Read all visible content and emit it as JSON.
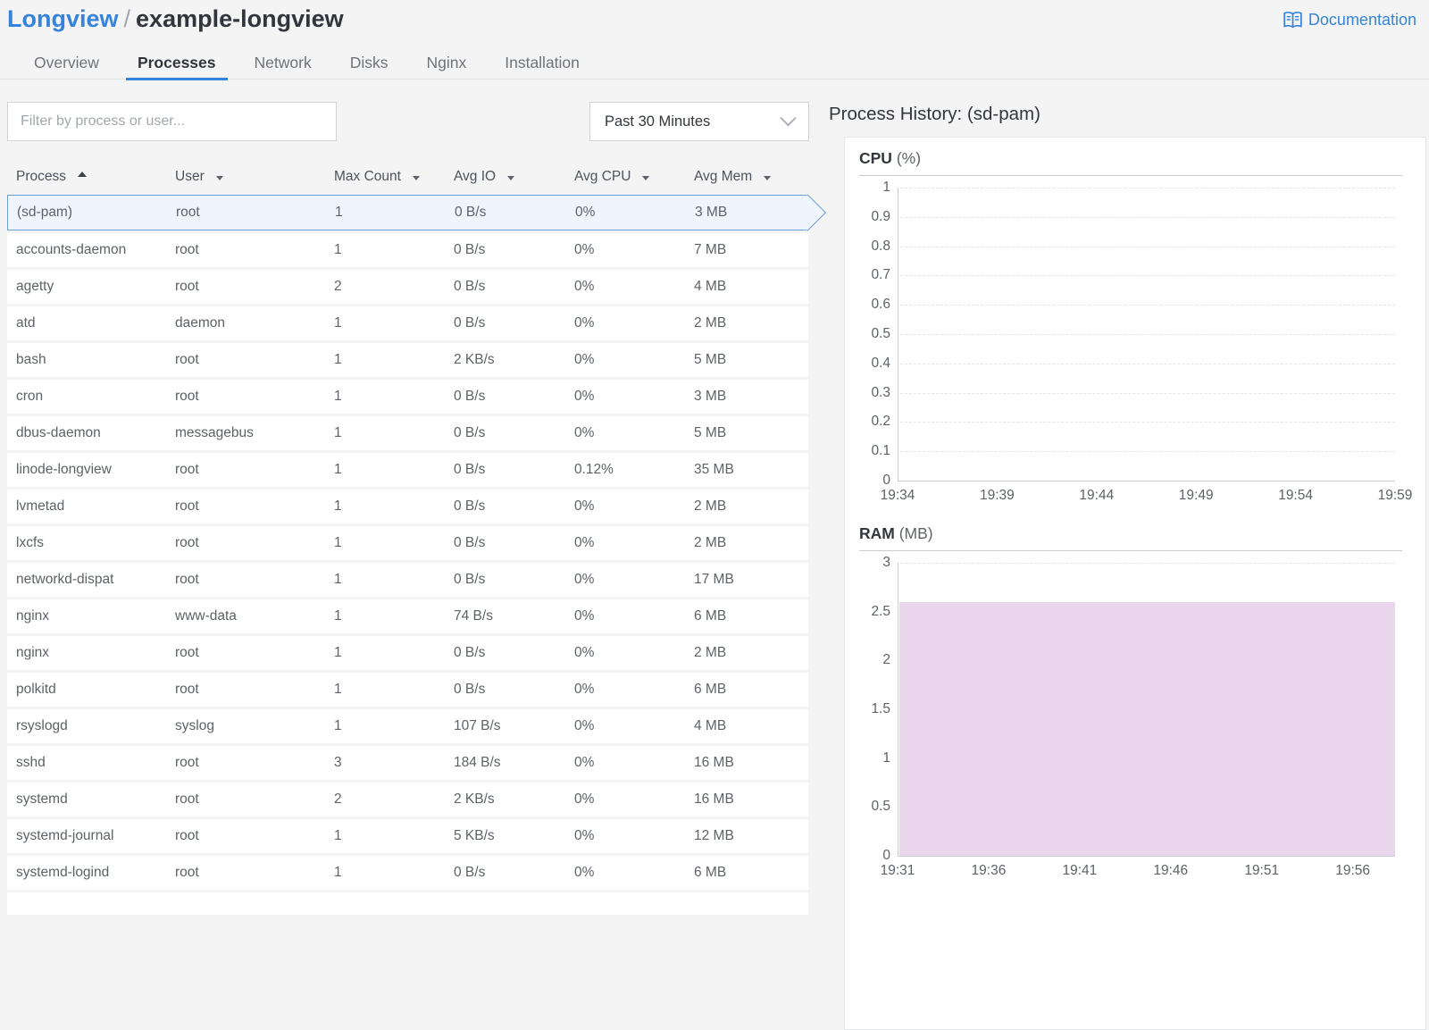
{
  "header": {
    "breadcrumb": {
      "section": "Longview",
      "separator": "/",
      "current": "example-longview"
    },
    "documentation_label": "Documentation"
  },
  "tabs": [
    {
      "label": "Overview",
      "active": false
    },
    {
      "label": "Processes",
      "active": true
    },
    {
      "label": "Network",
      "active": false
    },
    {
      "label": "Disks",
      "active": false
    },
    {
      "label": "Nginx",
      "active": false
    },
    {
      "label": "Installation",
      "active": false
    }
  ],
  "toolbar": {
    "filter_placeholder": "Filter by process or user...",
    "time_range_selected": "Past 30 Minutes"
  },
  "table": {
    "columns": [
      {
        "label": "Process",
        "sort": "asc"
      },
      {
        "label": "User",
        "sort": "none"
      },
      {
        "label": "Max Count",
        "sort": "none"
      },
      {
        "label": "Avg IO",
        "sort": "none"
      },
      {
        "label": "Avg CPU",
        "sort": "none"
      },
      {
        "label": "Avg Mem",
        "sort": "none"
      }
    ],
    "rows": [
      {
        "process": "(sd-pam)",
        "user": "root",
        "max_count": "1",
        "avg_io": "0 B/s",
        "avg_cpu": "0%",
        "avg_mem": "3 MB",
        "selected": true
      },
      {
        "process": "accounts-daemon",
        "user": "root",
        "max_count": "1",
        "avg_io": "0 B/s",
        "avg_cpu": "0%",
        "avg_mem": "7 MB",
        "selected": false
      },
      {
        "process": "agetty",
        "user": "root",
        "max_count": "2",
        "avg_io": "0 B/s",
        "avg_cpu": "0%",
        "avg_mem": "4 MB",
        "selected": false
      },
      {
        "process": "atd",
        "user": "daemon",
        "max_count": "1",
        "avg_io": "0 B/s",
        "avg_cpu": "0%",
        "avg_mem": "2 MB",
        "selected": false
      },
      {
        "process": "bash",
        "user": "root",
        "max_count": "1",
        "avg_io": "2 KB/s",
        "avg_cpu": "0%",
        "avg_mem": "5 MB",
        "selected": false
      },
      {
        "process": "cron",
        "user": "root",
        "max_count": "1",
        "avg_io": "0 B/s",
        "avg_cpu": "0%",
        "avg_mem": "3 MB",
        "selected": false
      },
      {
        "process": "dbus-daemon",
        "user": "messagebus",
        "max_count": "1",
        "avg_io": "0 B/s",
        "avg_cpu": "0%",
        "avg_mem": "5 MB",
        "selected": false
      },
      {
        "process": "linode-longview",
        "user": "root",
        "max_count": "1",
        "avg_io": "0 B/s",
        "avg_cpu": "0.12%",
        "avg_mem": "35 MB",
        "selected": false
      },
      {
        "process": "lvmetad",
        "user": "root",
        "max_count": "1",
        "avg_io": "0 B/s",
        "avg_cpu": "0%",
        "avg_mem": "2 MB",
        "selected": false
      },
      {
        "process": "lxcfs",
        "user": "root",
        "max_count": "1",
        "avg_io": "0 B/s",
        "avg_cpu": "0%",
        "avg_mem": "2 MB",
        "selected": false
      },
      {
        "process": "networkd-dispat",
        "user": "root",
        "max_count": "1",
        "avg_io": "0 B/s",
        "avg_cpu": "0%",
        "avg_mem": "17 MB",
        "selected": false
      },
      {
        "process": "nginx",
        "user": "www-data",
        "max_count": "1",
        "avg_io": "74 B/s",
        "avg_cpu": "0%",
        "avg_mem": "6 MB",
        "selected": false
      },
      {
        "process": "nginx",
        "user": "root",
        "max_count": "1",
        "avg_io": "0 B/s",
        "avg_cpu": "0%",
        "avg_mem": "2 MB",
        "selected": false
      },
      {
        "process": "polkitd",
        "user": "root",
        "max_count": "1",
        "avg_io": "0 B/s",
        "avg_cpu": "0%",
        "avg_mem": "6 MB",
        "selected": false
      },
      {
        "process": "rsyslogd",
        "user": "syslog",
        "max_count": "1",
        "avg_io": "107 B/s",
        "avg_cpu": "0%",
        "avg_mem": "4 MB",
        "selected": false
      },
      {
        "process": "sshd",
        "user": "root",
        "max_count": "3",
        "avg_io": "184 B/s",
        "avg_cpu": "0%",
        "avg_mem": "16 MB",
        "selected": false
      },
      {
        "process": "systemd",
        "user": "root",
        "max_count": "2",
        "avg_io": "2 KB/s",
        "avg_cpu": "0%",
        "avg_mem": "16 MB",
        "selected": false
      },
      {
        "process": "systemd-journal",
        "user": "root",
        "max_count": "1",
        "avg_io": "5 KB/s",
        "avg_cpu": "0%",
        "avg_mem": "12 MB",
        "selected": false
      },
      {
        "process": "systemd-logind",
        "user": "root",
        "max_count": "1",
        "avg_io": "0 B/s",
        "avg_cpu": "0%",
        "avg_mem": "6 MB",
        "selected": false
      }
    ]
  },
  "process_history": {
    "title": "Process History: (sd-pam)"
  },
  "chart_data": [
    {
      "type": "line",
      "title": "CPU (%)",
      "title_main": "CPU",
      "title_unit": "(%)",
      "x": [
        "19:34",
        "19:39",
        "19:44",
        "19:49",
        "19:54",
        "19:59"
      ],
      "series": [
        {
          "name": "CPU",
          "values": [
            0,
            0,
            0,
            0,
            0,
            0
          ]
        }
      ],
      "ylim": [
        0,
        1
      ],
      "y_ticks": [
        "1",
        "0.9",
        "0.8",
        "0.7",
        "0.6",
        "0.5",
        "0.4",
        "0.3",
        "0.2",
        "0.1",
        "0"
      ],
      "grid": true,
      "legend_position": "none"
    },
    {
      "type": "area",
      "title": "RAM (MB)",
      "title_main": "RAM",
      "title_unit": "(MB)",
      "x": [
        "19:31",
        "19:36",
        "19:41",
        "19:46",
        "19:51",
        "19:56"
      ],
      "series": [
        {
          "name": "RAM",
          "values": [
            2.6,
            2.6,
            2.6,
            2.6,
            2.6,
            2.6
          ]
        }
      ],
      "ylim": [
        0,
        3
      ],
      "y_ticks": [
        "3",
        "2.5",
        "2",
        "1.5",
        "1",
        "0.5",
        "0"
      ],
      "grid": true,
      "fill_color": "#e9d6ec",
      "legend_position": "none"
    }
  ],
  "colors": {
    "accent_blue": "#3683dc",
    "selected_row_bg": "#eef5fd",
    "selected_row_border": "#6b9fd8",
    "ram_area_fill": "#e9d6ec"
  }
}
